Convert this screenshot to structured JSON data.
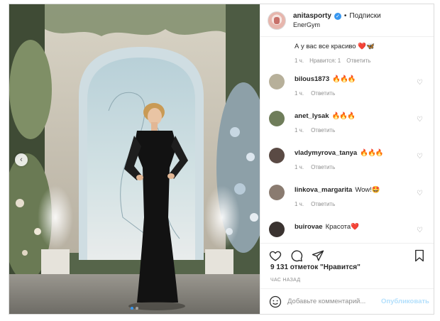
{
  "header": {
    "username": "anitasporty",
    "separator": "•",
    "follow_label": "Подписки",
    "location": "EnerGym"
  },
  "first_comment": {
    "text": "А у вас все красиво ❤️🦋",
    "time": "1 ч.",
    "likes": "Нравится: 1",
    "reply": "Ответить"
  },
  "comments": [
    {
      "user": "bilous1873",
      "text": "🔥🔥🔥",
      "time": "1 ч.",
      "reply": "Ответить",
      "avatar_color": "#b7b09a"
    },
    {
      "user": "anet_lysak",
      "text": "🔥🔥🔥",
      "time": "1 ч.",
      "reply": "Ответить",
      "avatar_color": "#6f7d5a"
    },
    {
      "user": "vladymyrova_tanya",
      "text": "🔥🔥🔥",
      "time": "1 ч.",
      "reply": "Ответить",
      "avatar_color": "#5a4a44"
    },
    {
      "user": "linkova_margarita",
      "text": "Wow!🤩",
      "time": "1 ч.",
      "reply": "Ответить",
      "avatar_color": "#8a7b70"
    },
    {
      "user": "buirovae",
      "text": "Красота❤️",
      "time": "",
      "reply": "",
      "avatar_color": "#3a3330"
    }
  ],
  "likes_text": "9 131 отметок \"Нравится\"",
  "time_ago": "ЧАС НАЗАД",
  "add_comment": {
    "placeholder": "Добавьте комментарий...",
    "publish_label": "Опубликовать"
  },
  "carousel": {
    "total": 2,
    "active": 1
  },
  "colors": {
    "accent": "#3897f0",
    "flame": "#f28b1d",
    "muted": "#8e8e8e"
  }
}
